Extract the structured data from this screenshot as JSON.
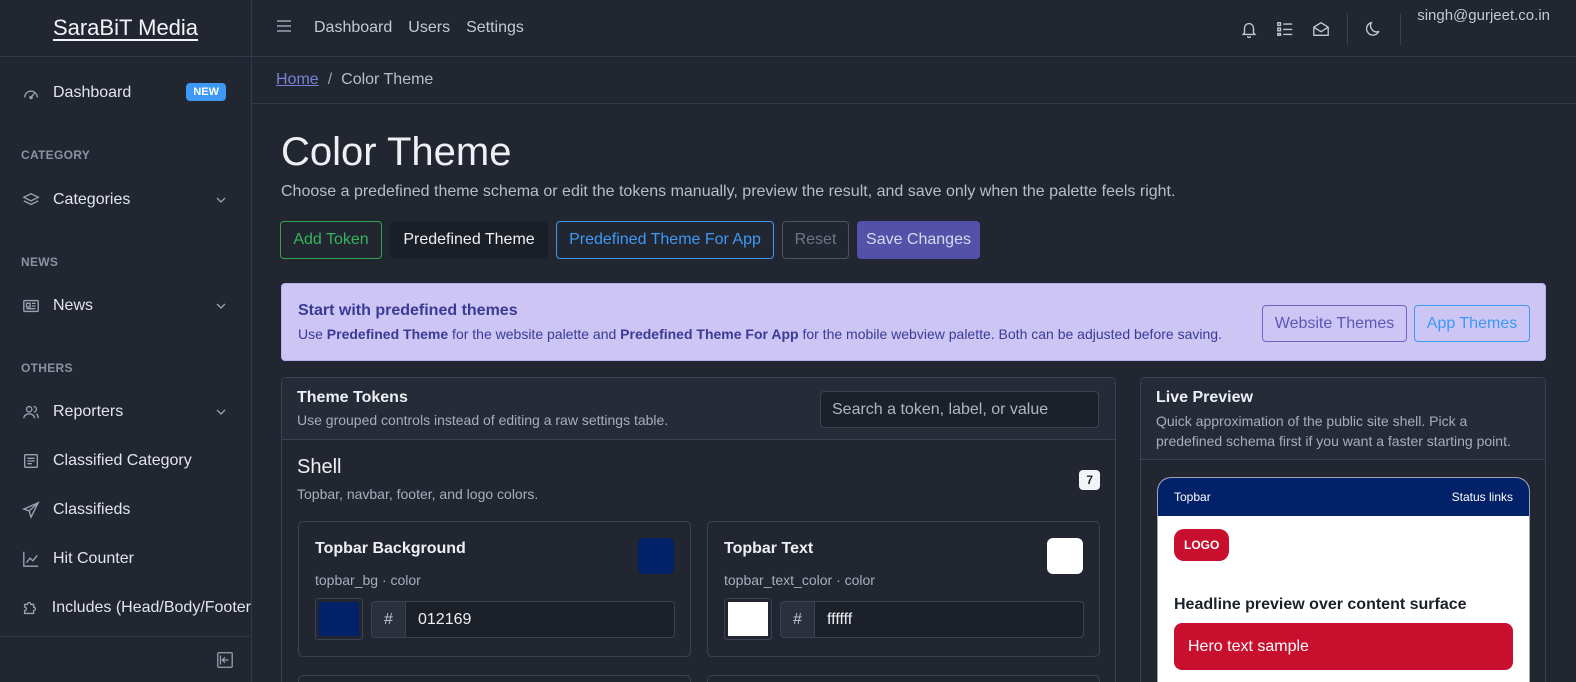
{
  "brand": "SaraBiT Media",
  "sidebar": {
    "dashboard": "Dashboard",
    "dashboard_badge": "NEW",
    "sections": [
      "CATEGORY",
      "NEWS",
      "OTHERS"
    ],
    "items": [
      {
        "label": "Categories",
        "icon": "layers-icon"
      },
      {
        "label": "News",
        "icon": "newspaper-icon"
      },
      {
        "label": "Reporters",
        "icon": "users-icon"
      },
      {
        "label": "Classified Category",
        "icon": "list-icon"
      },
      {
        "label": "Classifieds",
        "icon": "send-icon"
      },
      {
        "label": "Hit Counter",
        "icon": "chart-line-icon"
      },
      {
        "label": "Includes (Head/Body/Footer",
        "icon": "puzzle-icon"
      }
    ]
  },
  "header": {
    "nav": [
      "Dashboard",
      "Users",
      "Settings"
    ],
    "user_email": "singh@gurjeet.co.in"
  },
  "breadcrumb": {
    "home": "Home",
    "separator": "/",
    "current": "Color Theme"
  },
  "page": {
    "title": "Color Theme",
    "description": "Choose a predefined theme schema or edit the tokens manually, preview the result, and save only when the palette feels right."
  },
  "toolbar": {
    "add_token": "Add Token",
    "predefined_theme": "Predefined Theme",
    "predefined_theme_app": "Predefined Theme For App",
    "reset": "Reset",
    "save": "Save Changes"
  },
  "alert": {
    "title": "Start with predefined themes",
    "text_1": "Use ",
    "bold_1": "Predefined Theme",
    "text_2": " for the website palette and ",
    "bold_2": "Predefined Theme For App",
    "text_3": " for the mobile webview palette. Both can be adjusted before saving.",
    "website_btn": "Website Themes",
    "app_btn": "App Themes"
  },
  "tokens": {
    "title": "Theme Tokens",
    "subtitle": "Use grouped controls instead of editing a raw settings table.",
    "search_placeholder": "Search a token, label, or value",
    "group": {
      "title": "Shell",
      "subtitle": "Topbar, navbar, footer, and logo colors.",
      "count": "7",
      "items": [
        {
          "label": "Topbar Background",
          "key": "topbar_bg · color",
          "hash": "#",
          "value": "012169",
          "color": "#012169"
        },
        {
          "label": "Topbar Text",
          "key": "topbar_text_color · color",
          "hash": "#",
          "value": "ffffff",
          "color": "#ffffff"
        }
      ]
    }
  },
  "preview": {
    "title": "Live Preview",
    "subtitle": "Quick approximation of the public site shell. Pick a predefined schema first if you want a faster starting point.",
    "topbar_left": "Topbar",
    "topbar_right": "Status links",
    "logo": "LOGO",
    "headline": "Headline preview over content surface",
    "hero": "Hero text sample"
  },
  "colors": {
    "accent": "#5452a8",
    "topbar": "#012169",
    "brand_red": "#c8102e"
  }
}
